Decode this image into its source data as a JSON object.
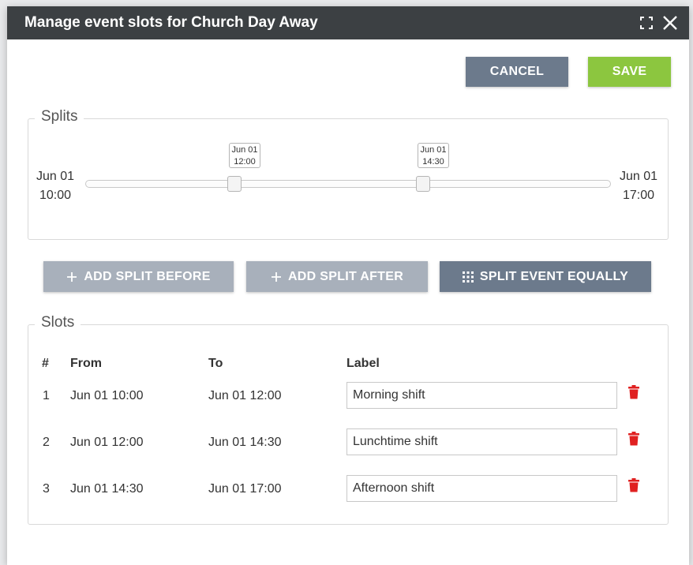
{
  "modal": {
    "title": "Manage event slots for Church Day Away",
    "icons": [
      "expand-icon",
      "close-icon"
    ]
  },
  "toolbar": {
    "cancel_label": "CANCEL",
    "save_label": "SAVE"
  },
  "splits": {
    "legend": "Splits",
    "start": {
      "date": "Jun 01",
      "time": "10:00"
    },
    "end": {
      "date": "Jun 01",
      "time": "17:00"
    },
    "handles": [
      {
        "date": "Jun 01",
        "time": "12:00"
      },
      {
        "date": "Jun 01",
        "time": "14:30"
      }
    ]
  },
  "actions": {
    "add_before": "ADD SPLIT BEFORE",
    "add_after": "ADD SPLIT AFTER",
    "split_equally": "SPLIT EVENT EQUALLY"
  },
  "slots": {
    "legend": "Slots",
    "columns": [
      "#",
      "From",
      "To",
      "Label"
    ],
    "rows": [
      {
        "num": "1",
        "from": "Jun 01 10:00",
        "to": "Jun 01 12:00",
        "label": "Morning shift"
      },
      {
        "num": "2",
        "from": "Jun 01 12:00",
        "to": "Jun 01 14:30",
        "label": "Lunchtime shift"
      },
      {
        "num": "3",
        "from": "Jun 01 14:30",
        "to": "Jun 01 17:00",
        "label": "Afternoon shift"
      }
    ]
  },
  "colors": {
    "header": "#3c4043",
    "save": "#8cc63f",
    "cancel": "#6c7a8c",
    "disabled": "#a8b0bb",
    "delete": "#e02020"
  }
}
